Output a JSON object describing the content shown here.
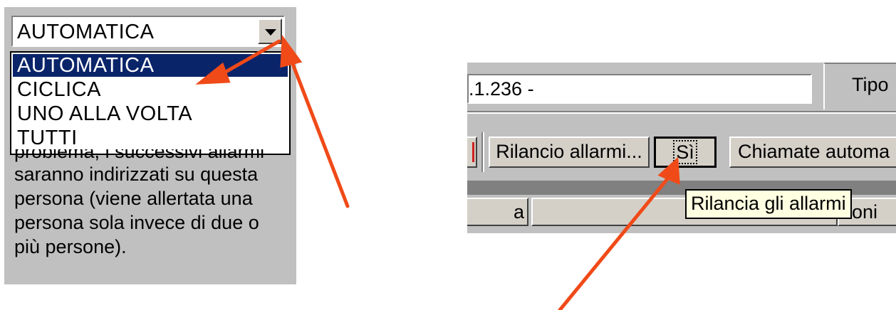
{
  "left": {
    "combo": {
      "value": "AUTOMATICA",
      "button_icon": "chevron-down-icon"
    },
    "dropdown": {
      "items": [
        {
          "label": "AUTOMATICA",
          "selected": true
        },
        {
          "label": "CICLICA",
          "selected": false
        },
        {
          "label": "UNO ALLA VOLTA",
          "selected": false
        },
        {
          "label": "TUTTI",
          "selected": false
        }
      ]
    },
    "help_lines": [
      "problema, i successivi allarmi",
      "saranno indirizzati su questa",
      "persona (viene allertata una",
      "persona sola invece di due o",
      "più persone)."
    ]
  },
  "right": {
    "field_value": ".1.236 -",
    "tipo_label": "Tipo",
    "buttons": {
      "rilancio": "Rilancio allarmi...",
      "si": "Sì",
      "chiamate": "Chiamate automa"
    },
    "tabs": {
      "left": "a",
      "right": "oni"
    },
    "tooltip": "Rilancia gli allarmi"
  },
  "colors": {
    "arrow": "#f04a18",
    "selection": "#0a246a",
    "panel": "#c0c0c0",
    "tooltip_bg": "#ffffe1"
  }
}
